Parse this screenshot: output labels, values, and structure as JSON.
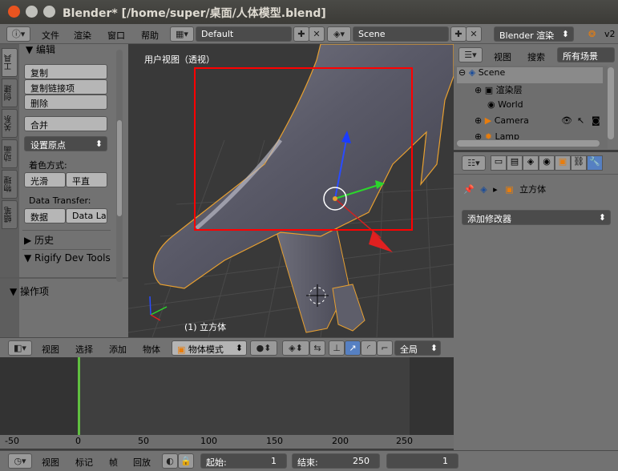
{
  "window": {
    "title": "Blender* [/home/super/桌面/人体模型.blend]",
    "colors": {
      "close": "#e95420",
      "min": "#c0c0bb",
      "max": "#c0c0bb"
    }
  },
  "info_header": {
    "menus": [
      "文件",
      "渲染",
      "窗口",
      "帮助"
    ],
    "screen_layout": "Default",
    "scene": "Scene",
    "engine": "Blender 渲染",
    "version_fragment": "v2"
  },
  "tool_shelf": {
    "tabs": [
      "工具",
      "创建",
      "关系",
      "动画",
      "物理",
      "蜡笔"
    ],
    "edit_header": "编辑",
    "buttons": [
      "复制",
      "复制链接项",
      "删除",
      "合并",
      "设置原点"
    ],
    "shading_label": "着色方式:",
    "shading_smooth": "光滑",
    "shading_flat": "平直",
    "data_transfer_label": "Data Transfer:",
    "data_btn": "数据",
    "data_layer_btn": "Data La",
    "history": "历史",
    "rigify": "Rigify Dev Tools",
    "operator": "操作项"
  },
  "viewport": {
    "view_name": "用户视图（透视）",
    "object_label": "(1) 立方体",
    "highlight_color": "#ff0000"
  },
  "outliner": {
    "view_menu": "视图",
    "search_menu": "搜索",
    "filter": "所有场景",
    "items": [
      "Scene",
      "渲染层",
      "World",
      "Camera",
      "Lamp"
    ]
  },
  "properties": {
    "object_name": "立方体",
    "add_modifier": "添加修改器"
  },
  "view3d_header": {
    "menus": [
      "视图",
      "选择",
      "添加",
      "物体"
    ],
    "mode": "物体模式",
    "pivot": "全局"
  },
  "timeline": {
    "ticks": [
      "-50",
      "0",
      "50",
      "100",
      "150",
      "200",
      "250"
    ],
    "menus": [
      "视图",
      "标记",
      "帧",
      "回放"
    ],
    "start_label": "起始:",
    "start_value": "1",
    "end_label": "结束:",
    "end_value": "250",
    "current_frame": "1"
  }
}
